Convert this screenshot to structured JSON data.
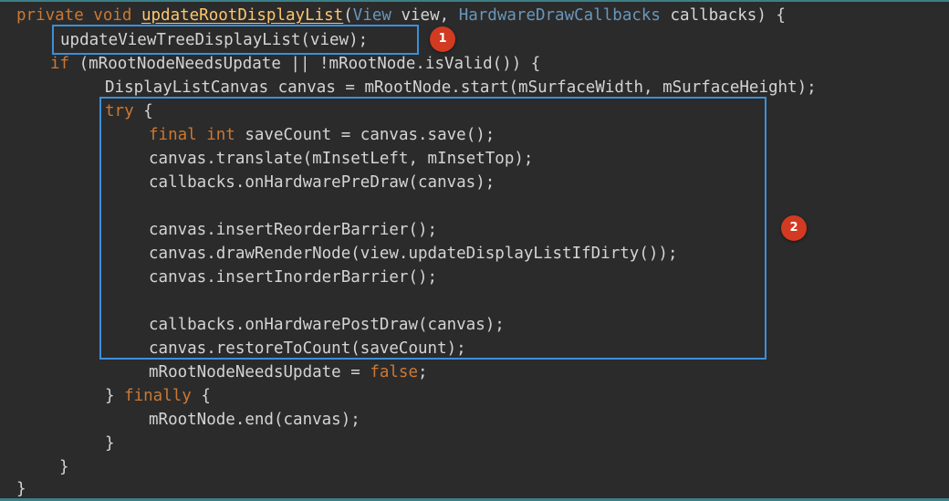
{
  "colors": {
    "background": "#2b2b2b",
    "keyword": "#cc7832",
    "method_name": "#ffc66d",
    "type": "#6897bb",
    "plain_text": "#d4d4d4",
    "highlight_box": "#3d8fd8",
    "badge": "#d23a22"
  },
  "code": {
    "l1": {
      "kw": "private void ",
      "fn": "updateRootDisplayList",
      "p1": "(",
      "t1": "View",
      "p2": " view, ",
      "t2": "HardwareDrawCallbacks",
      "p3": " callbacks) {"
    },
    "l2": {
      "text": "updateViewTreeDisplayList(view);"
    },
    "l3": {
      "kw": "if",
      "text": " (mRootNodeNeedsUpdate || !mRootNode.isValid()) {"
    },
    "l4": {
      "text": "DisplayListCanvas canvas = mRootNode.start(mSurfaceWidth, mSurfaceHeight);"
    },
    "l5": {
      "kw": "try",
      "text": " {"
    },
    "l6": {
      "kw": "final int",
      "text": " saveCount = canvas.save();"
    },
    "l7": {
      "text": "canvas.translate(mInsetLeft, mInsetTop);"
    },
    "l8": {
      "text": "callbacks.onHardwarePreDraw(canvas);"
    },
    "l9": {
      "text": "canvas.insertReorderBarrier();"
    },
    "l10": {
      "text": "canvas.drawRenderNode(view.updateDisplayListIfDirty());"
    },
    "l11": {
      "text": "canvas.insertInorderBarrier();"
    },
    "l12": {
      "text": "callbacks.onHardwarePostDraw(canvas);"
    },
    "l13": {
      "text": "canvas.restoreToCount(saveCount);"
    },
    "l14": {
      "text": "mRootNodeNeedsUpdate = ",
      "kw": "false",
      "end": ";"
    },
    "l15": {
      "text1": "} ",
      "kw": "finally",
      "text2": " {"
    },
    "l16": {
      "text": "mRootNode.end(canvas);"
    },
    "l17": {
      "text": "}"
    },
    "l18": {
      "text": "}"
    },
    "l19": {
      "text": "}"
    }
  },
  "annotations": {
    "badge1": "1",
    "badge2": "2"
  }
}
